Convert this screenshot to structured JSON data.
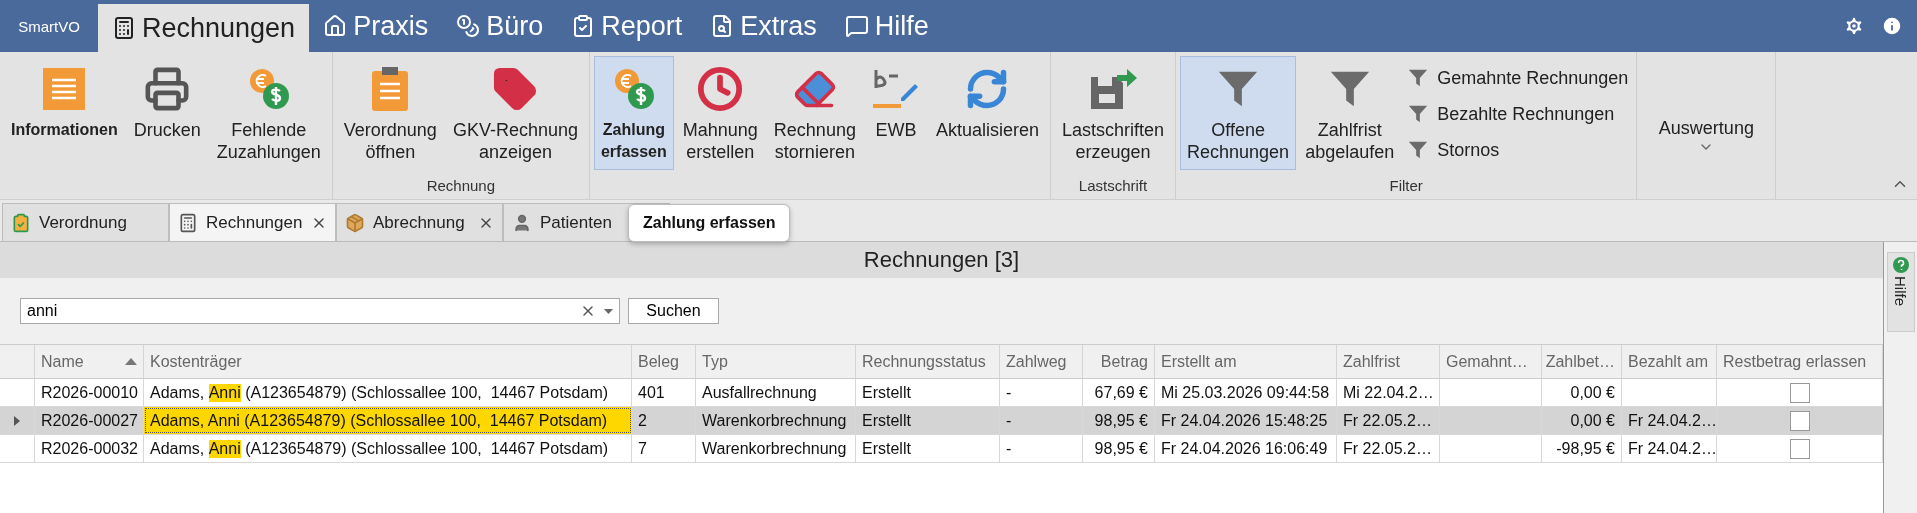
{
  "app_menu": {
    "label": "SmartVO"
  },
  "menu_tabs": [
    {
      "label": "Rechnungen",
      "selected": true
    },
    {
      "label": "Praxis",
      "selected": false
    },
    {
      "label": "Büro",
      "selected": false
    },
    {
      "label": "Report",
      "selected": false
    },
    {
      "label": "Extras",
      "selected": false
    },
    {
      "label": "Hilfe",
      "selected": false
    }
  ],
  "ribbon": {
    "groups": [
      {
        "items": [
          {
            "kind": "large",
            "label": "Informationen",
            "bold": true,
            "selected": false
          },
          {
            "kind": "large",
            "label": "Drucken",
            "bold": false,
            "selected": false
          },
          {
            "kind": "large",
            "label": "Fehlende\nZuzahlungen",
            "bold": false,
            "selected": false
          }
        ]
      },
      {
        "label": "Rechnung",
        "items": [
          {
            "kind": "large",
            "label": "Verordnung\nöffnen",
            "bold": false,
            "selected": false
          },
          {
            "kind": "large",
            "label": "GKV-Rechnung\nanzeigen",
            "bold": false,
            "selected": false
          }
        ]
      },
      {
        "items": [
          {
            "kind": "large",
            "label": "Zahlung\nerfassen",
            "bold": true,
            "selected": true
          },
          {
            "kind": "large",
            "label": "Mahnung\nerstellen",
            "bold": false,
            "selected": false
          },
          {
            "kind": "large",
            "label": "Rechnung\nstornieren",
            "bold": false,
            "selected": false
          },
          {
            "kind": "large",
            "label": "EWB",
            "bold": false,
            "selected": false
          },
          {
            "kind": "large",
            "label": "Aktualisieren",
            "bold": false,
            "selected": false
          }
        ]
      },
      {
        "label": "Lastschrift",
        "items": [
          {
            "kind": "large",
            "label": "Lastschriften\nerzeugen",
            "bold": false,
            "selected": false
          }
        ]
      },
      {
        "label": "Filter",
        "items": [
          {
            "kind": "large",
            "label": "Offene\nRechnungen",
            "bold": false,
            "selected": true
          },
          {
            "kind": "large",
            "label": "Zahlfrist\nabgelaufen",
            "bold": false,
            "selected": false
          },
          {
            "kind": "small",
            "label": "Gemahnte Rechnungen"
          },
          {
            "kind": "small",
            "label": "Bezahlte Rechnungen"
          },
          {
            "kind": "small",
            "label": "Stornos"
          }
        ]
      },
      {
        "items": [
          {
            "kind": "dropdown",
            "label": "Auswertung"
          }
        ]
      }
    ]
  },
  "doc_tabs": [
    {
      "label": "Verordnung",
      "selected": false
    },
    {
      "label": "Rechnungen",
      "selected": true,
      "closable": true
    },
    {
      "label": "Abrechnung",
      "selected": false,
      "closable": true
    },
    {
      "label": "Patienten",
      "selected": false
    }
  ],
  "tooltip": "Zahlung erfassen",
  "panel": {
    "title": "Rechnungen [3]",
    "search": {
      "value": "anni"
    },
    "search_button": "Suchen"
  },
  "table": {
    "columns": [
      {
        "label": "Name",
        "sorted_ascending": true
      },
      {
        "label": "Kostenträger"
      },
      {
        "label": "Beleg"
      },
      {
        "label": "Typ"
      },
      {
        "label": "Rechnungsstatus"
      },
      {
        "label": "Zahlweg"
      },
      {
        "label": "Betrag"
      },
      {
        "label": "Erstellt am"
      },
      {
        "label": "Zahlfrist"
      },
      {
        "label": "Gemahnt…"
      },
      {
        "label": "Zahlbet…"
      },
      {
        "label": "Bezahlt am"
      },
      {
        "label": "Restbetrag erlassen"
      }
    ],
    "rows": [
      {
        "selected": false,
        "name": "R2026-00010",
        "payer": {
          "before": "Adams, ",
          "match": "Anni",
          "after": " (A123654879) (Schlossallee 100,  14467 Potsdam)"
        },
        "beleg": "401",
        "typ": "Ausfallrechnung",
        "status": "Erstellt",
        "zahlweg": "-",
        "betrag": "67,69 €",
        "erstellt": "Mi 25.03.2026 09:44:58",
        "zahlfrist": "Mi 22.04.2…",
        "zahlbetrag": "0,00 €",
        "restbetrag_erlassen": false
      },
      {
        "selected": true,
        "name": "R2026-00027",
        "payer": {
          "before": "Adams, ",
          "match": "Anni",
          "after": " (A123654879) (Schlossallee 100,  14467 Potsdam)"
        },
        "beleg": "2",
        "typ": "Warenkorbrechnung",
        "status": "Erstellt",
        "zahlweg": "-",
        "betrag": "98,95 €",
        "erstellt": "Fr 24.04.2026 15:48:25",
        "zahlfrist": "Fr 22.05.2…",
        "zahlbetrag": "0,00 €",
        "bezahlt": "Fr 24.04.2…",
        "restbetrag_erlassen": false
      },
      {
        "selected": false,
        "name": "R2026-00032",
        "payer": {
          "before": "Adams, ",
          "match": "Anni",
          "after": " (A123654879) (Schlossallee 100,  14467 Potsdam)"
        },
        "beleg": "7",
        "typ": "Warenkorbrechnung",
        "status": "Erstellt",
        "zahlweg": "-",
        "betrag": "98,95 €",
        "erstellt": "Fr 24.04.2026 16:06:49",
        "zahlfrist": "Fr 22.05.2…",
        "zahlbetrag": "-98,95 €",
        "bezahlt": "Fr 24.04.2…",
        "restbetrag_erlassen": false
      }
    ]
  },
  "side_tab": {
    "label": "Hilfe"
  }
}
